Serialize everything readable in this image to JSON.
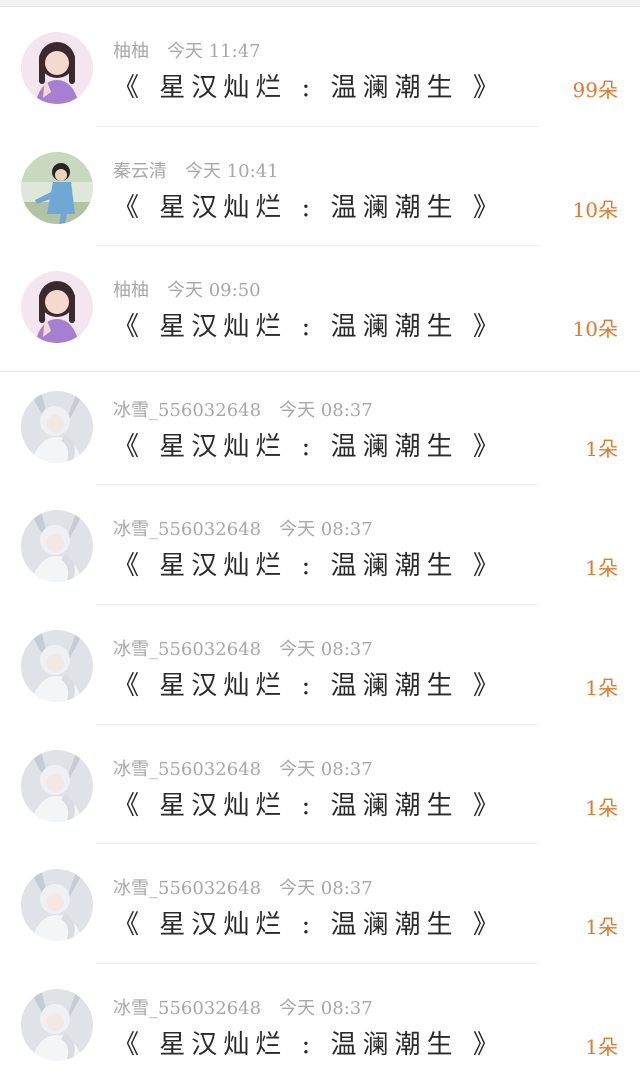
{
  "gifts": [
    {
      "name": "柚柚",
      "time": "今天 11:47",
      "title": "《 星汉灿烂 : 温澜潮生 》",
      "count": "99朵",
      "avatar": "girl-purple-avatar-icon"
    },
    {
      "name": "秦云清",
      "time": "今天 10:41",
      "title": "《 星汉灿烂 : 温澜潮生 》",
      "count": "10朵",
      "avatar": "boy-blue-avatar-icon"
    },
    {
      "name": "柚柚",
      "time": "今天 09:50",
      "title": "《 星汉灿烂 : 温澜潮生 》",
      "count": "10朵",
      "avatar": "girl-purple-avatar-icon"
    },
    {
      "name": "冰雪_556032648",
      "time": "今天 08:37",
      "title": "《 星汉灿烂 : 温澜潮生 》",
      "count": "1朵",
      "avatar": "girl-white-avatar-icon"
    },
    {
      "name": "冰雪_556032648",
      "time": "今天 08:37",
      "title": "《 星汉灿烂 : 温澜潮生 》",
      "count": "1朵",
      "avatar": "girl-white-avatar-icon"
    },
    {
      "name": "冰雪_556032648",
      "time": "今天 08:37",
      "title": "《 星汉灿烂 : 温澜潮生 》",
      "count": "1朵",
      "avatar": "girl-white-avatar-icon"
    },
    {
      "name": "冰雪_556032648",
      "time": "今天 08:37",
      "title": "《 星汉灿烂 : 温澜潮生 》",
      "count": "1朵",
      "avatar": "girl-white-avatar-icon"
    },
    {
      "name": "冰雪_556032648",
      "time": "今天 08:37",
      "title": "《 星汉灿烂 : 温澜潮生 》",
      "count": "1朵",
      "avatar": "girl-white-avatar-icon"
    },
    {
      "name": "冰雪_556032648",
      "time": "今天 08:37",
      "title": "《 星汉灿烂 : 温澜潮生 》",
      "count": "1朵",
      "avatar": "girl-white-avatar-icon"
    }
  ],
  "colors": {
    "count": "#e8772a",
    "meta": "#a8a8a8",
    "title": "#2a2a2a"
  }
}
